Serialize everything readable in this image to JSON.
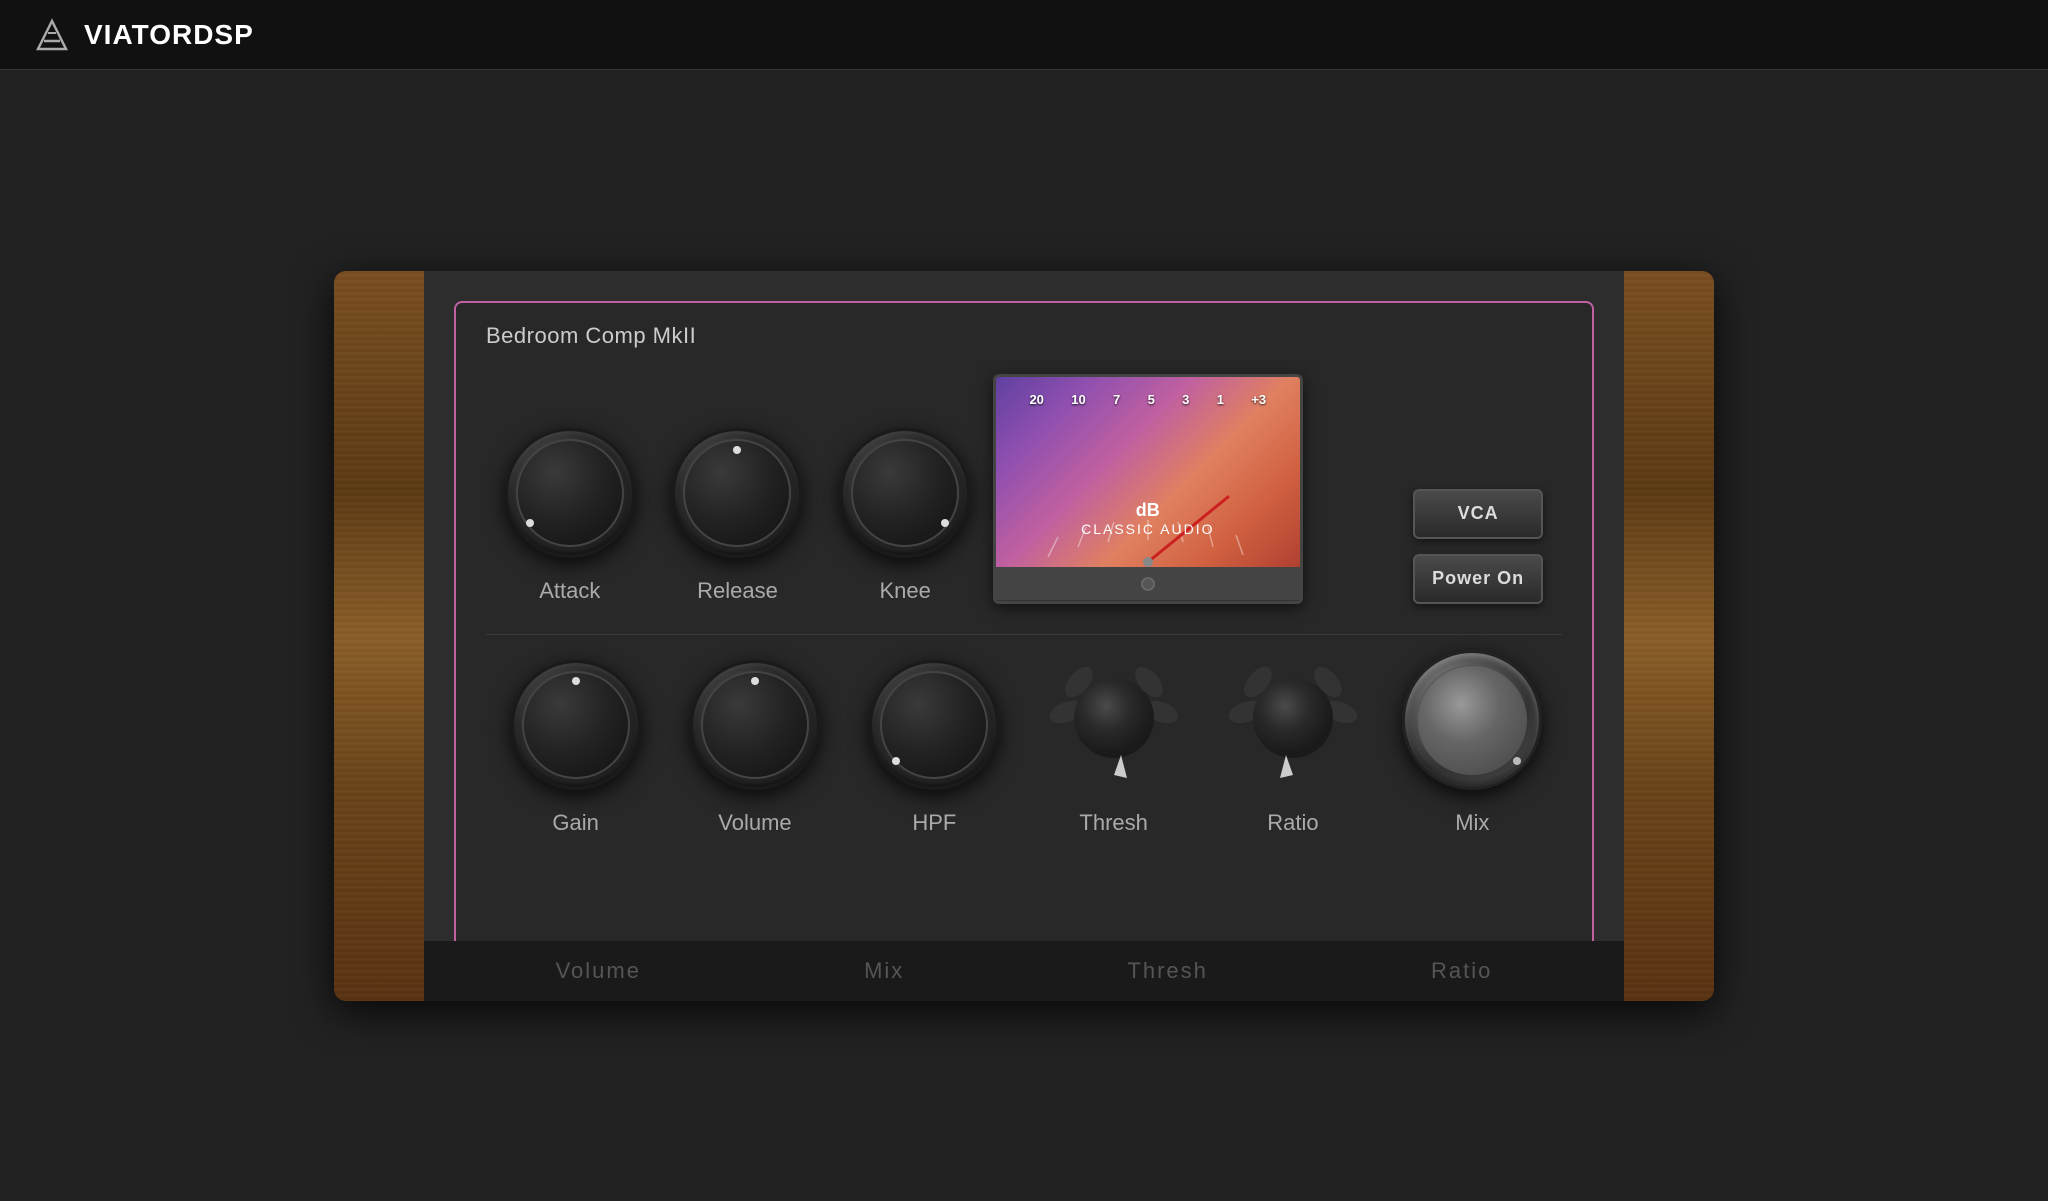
{
  "header": {
    "logo_text_bold": "DSP",
    "logo_text_light": "VIATOR"
  },
  "plugin": {
    "title": "Bedroom Comp MkII",
    "border_color": "#c060a0"
  },
  "knobs_row1": [
    {
      "id": "attack",
      "label": "Attack",
      "indicator_pos": "bottom-left"
    },
    {
      "id": "release",
      "label": "Release",
      "indicator_pos": "top"
    },
    {
      "id": "knee",
      "label": "Knee",
      "indicator_pos": "bottom-right"
    }
  ],
  "knobs_row2": [
    {
      "id": "gain",
      "label": "Gain",
      "indicator_pos": "top"
    },
    {
      "id": "volume",
      "label": "Volume",
      "indicator_pos": "top"
    },
    {
      "id": "hpf",
      "label": "HPF",
      "indicator_pos": "bottom-left"
    },
    {
      "id": "thresh",
      "label": "Thresh",
      "type": "thumb"
    },
    {
      "id": "ratio",
      "label": "Ratio",
      "type": "thumb"
    },
    {
      "id": "mix",
      "label": "Mix",
      "type": "silver"
    }
  ],
  "vu_meter": {
    "db_label": "dB",
    "subtitle": "CLASSIC AUDIO",
    "scale": [
      "20",
      "10",
      "7",
      "5",
      "3",
      "1",
      "+3"
    ]
  },
  "buttons": [
    {
      "id": "vca",
      "label": "VCA"
    },
    {
      "id": "power",
      "label": "Power On"
    }
  ],
  "bottom_labels": [
    "Volume",
    "Mix",
    "Thresh",
    "Ratio"
  ]
}
